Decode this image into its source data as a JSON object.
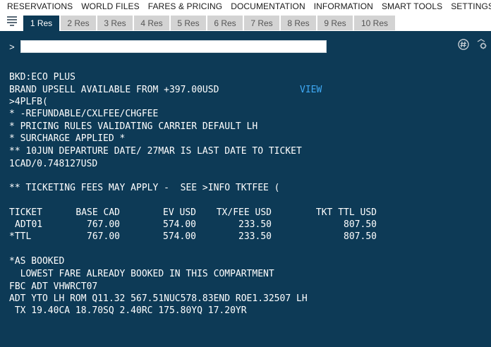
{
  "menu": [
    "RESERVATIONS",
    "WORLD FILES",
    "FARES & PRICING",
    "DOCUMENTATION",
    "INFORMATION",
    "SMART TOOLS",
    "SETTINGS"
  ],
  "tabs": [
    "1 Res",
    "2 Res",
    "3 Res",
    "4 Res",
    "5 Res",
    "6 Res",
    "7 Res",
    "8 Res",
    "9 Res",
    "10 Res"
  ],
  "active_tab": "1 Res",
  "icons": {
    "menu": "list-icon",
    "hash": "hash-circle-icon",
    "settings": "gear-arrow-icon"
  },
  "colors": {
    "terminal_bg": "#0d3a56",
    "link": "#3fa9f5",
    "tab_inactive": "#d3d3d3"
  },
  "command": {
    "prompt": ">",
    "value": ""
  },
  "response": {
    "bkd": "BKD:ECO PLUS",
    "brand_upsell": "BRAND UPSELL AVAILABLE FROM +397.00USD",
    "view_link": "VIEW",
    "entry": ">4PLFB(",
    "note1": "* -REFUNDABLE/CXLFEE/CHGFEE",
    "note2": "* PRICING RULES VALIDATING CARRIER DEFAULT LH",
    "note3": "* SURCHARGE APPLIED *",
    "note4": "** 10JUN DEPARTURE DATE/ 27MAR IS LAST DATE TO TICKET",
    "rate": "1CAD/0.748127USD",
    "fees": "** TICKETING FEES MAY APPLY -  SEE >INFO TKTFEE (",
    "table": {
      "headers": [
        "TICKET",
        "BASE CAD",
        "EV USD",
        "TX/FEE USD",
        "TKT TTL USD"
      ],
      "rows": [
        [
          "ADT01",
          "767.00",
          "574.00",
          "233.50",
          "807.50"
        ],
        [
          "*TTL",
          "767.00",
          "574.00",
          "233.50",
          "807.50"
        ]
      ]
    },
    "as_booked": "*AS BOOKED",
    "lowest": "  LOWEST FARE ALREADY BOOKED IN THIS COMPARTMENT",
    "fbc": "FBC ADT VHWRCT07",
    "fare_calc": "ADT YTO LH ROM Q11.32 567.51NUC578.83END ROE1.32507 LH",
    "tax": " TX 19.40CA 18.70SQ 2.40RC 175.80YQ 17.20YR"
  }
}
